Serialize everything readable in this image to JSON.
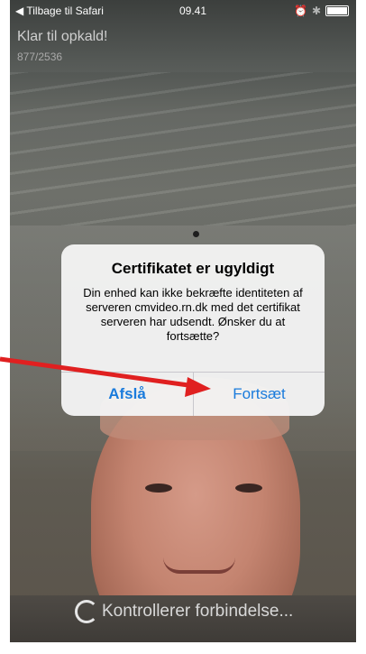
{
  "status": {
    "back_label": "◀ Tilbage til Safari",
    "time": "09.41"
  },
  "call": {
    "title": "Klar til opkald!",
    "number": "877/2536"
  },
  "alert": {
    "title": "Certifikatet er ugyldigt",
    "message": "Din enhed kan ikke bekræfte identiteten af serveren cmvideo.rn.dk med det certifikat serveren har udsendt. Ønsker du at fortsætte?",
    "cancel_label": "Afslå",
    "continue_label": "Fortsæt"
  },
  "footer": {
    "status_text": "Kontrollerer forbindelse..."
  },
  "colors": {
    "accent": "#1a7bdc",
    "annotation_arrow": "#e02020"
  },
  "icons": [
    "back-icon",
    "alarm-icon",
    "bluetooth-icon",
    "battery-icon",
    "spinner-icon",
    "arrow-annotation-icon"
  ]
}
